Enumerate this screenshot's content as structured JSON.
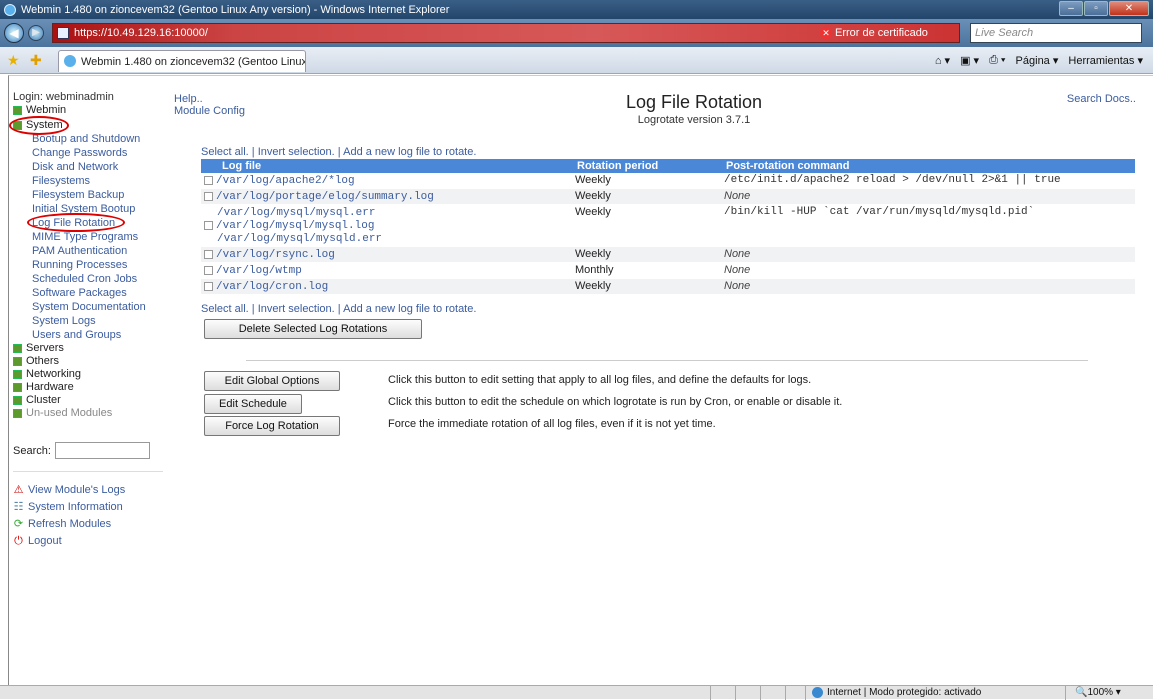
{
  "window": {
    "title": "Webmin 1.480 on zioncevem32 (Gentoo Linux Any version) - Windows Internet Explorer",
    "url": "https://10.49.129.16:10000/",
    "cert_error": "Error de certificado",
    "search_placeholder": "Live Search",
    "tab_title": "Webmin 1.480 on zioncevem32 (Gentoo Linux An...",
    "tool_page": "Página ▾",
    "tool_tools": "Herramientas ▾"
  },
  "sidebar": {
    "login": "Login: webminadmin",
    "cat_webmin": "Webmin",
    "cat_system": "System",
    "modules": [
      "Bootup and Shutdown",
      "Change Passwords",
      "Disk and Network Filesystems",
      "Filesystem Backup",
      "Initial System Bootup",
      "Log File Rotation",
      "MIME Type Programs",
      "PAM Authentication",
      "Running Processes",
      "Scheduled Cron Jobs",
      "Software Packages",
      "System Documentation",
      "System Logs",
      "Users and Groups"
    ],
    "disk_line2": "Filesystems",
    "disk_line1": "Disk and Network",
    "cat_servers": "Servers",
    "cat_others": "Others",
    "cat_networking": "Networking",
    "cat_hardware": "Hardware",
    "cat_cluster": "Cluster",
    "cat_unused": "Un-used Modules",
    "search_label": "Search:",
    "view_logs": "View Module's Logs",
    "system_info": "System Information",
    "refresh": "Refresh Modules",
    "logout": "Logout"
  },
  "main": {
    "help": "Help..",
    "module_config": "Module Config",
    "title": "Log File Rotation",
    "subtitle": "Logrotate version 3.7.1",
    "search_docs": "Search Docs..",
    "select_all": "Select all.",
    "invert": "Invert selection.",
    "add_new": "Add a new log file to rotate.",
    "sep": "|",
    "columns": [
      "Log file",
      "Rotation period",
      "Post-rotation command"
    ],
    "rows": [
      {
        "files": [
          "/var/log/apache2/*log"
        ],
        "period": "Weekly",
        "cmd": "/etc/init.d/apache2 reload > /dev/null 2>&1 || true"
      },
      {
        "files": [
          "/var/log/portage/elog/summary.log"
        ],
        "period": "Weekly",
        "cmd": "None"
      },
      {
        "files": [
          "/var/log/mysql/mysql.err",
          "/var/log/mysql/mysql.log",
          "/var/log/mysql/mysqld.err"
        ],
        "period": "Weekly",
        "cmd": "/bin/kill -HUP `cat /var/run/mysqld/mysqld.pid`"
      },
      {
        "files": [
          "/var/log/rsync.log"
        ],
        "period": "Weekly",
        "cmd": "None"
      },
      {
        "files": [
          "/var/log/wtmp"
        ],
        "period": "Monthly",
        "cmd": "None"
      },
      {
        "files": [
          "/var/log/cron.log"
        ],
        "period": "Weekly",
        "cmd": "None"
      }
    ],
    "delete_btn": "Delete Selected Log Rotations",
    "edit_global_btn": "Edit Global Options",
    "edit_global_desc": "Click this button to edit setting that apply to all log files, and define the defaults for logs.",
    "edit_schedule_btn": "Edit Schedule",
    "edit_schedule_desc": "Click this button to edit the schedule on which logrotate is run by Cron, or enable or disable it.",
    "force_btn": "Force Log Rotation",
    "force_desc": "Force the immediate rotation of all log files, even if it is not yet time."
  },
  "status": {
    "zone": "Internet | Modo protegido: activado",
    "zoom": "100%"
  }
}
